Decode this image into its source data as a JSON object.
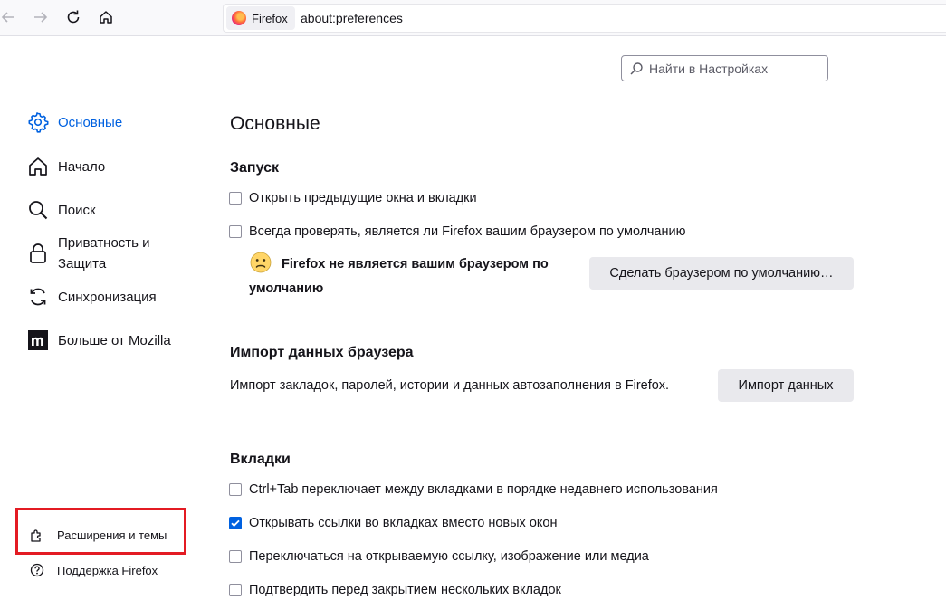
{
  "browser": {
    "identity_label": "Firefox",
    "url": "about:preferences"
  },
  "search": {
    "placeholder": "Найти в Настройках"
  },
  "sidebar": {
    "items": [
      {
        "label": "Основные",
        "icon": "gear-icon",
        "selected": true
      },
      {
        "label": "Начало",
        "icon": "home-icon"
      },
      {
        "label": "Поиск",
        "icon": "search-icon"
      },
      {
        "label_line1": "Приватность и",
        "label_line2": "Защита",
        "icon": "lock-icon"
      },
      {
        "label": "Синхронизация",
        "icon": "sync-icon"
      },
      {
        "label": "Больше от Mozilla",
        "icon": "mozilla-m-icon"
      }
    ],
    "footer": {
      "extensions": "Расширения и темы",
      "support": "Поддержка Firefox"
    }
  },
  "main": {
    "title": "Основные",
    "startup": {
      "heading": "Запуск",
      "restore_session": {
        "label": "Открыть предыдущие окна и вкладки",
        "checked": false
      },
      "check_default": {
        "label": "Всегда проверять, является ли Firefox вашим браузером по умолчанию",
        "checked": false
      },
      "not_default_line1": "Firefox не является вашим браузером по",
      "not_default_line2": "умолчанию",
      "make_default_button": "Сделать браузером по умолчанию…"
    },
    "import": {
      "heading": "Импорт данных браузера",
      "description": "Импорт закладок, паролей, истории и данных автозаполнения в Firefox.",
      "button": "Импорт данных"
    },
    "tabs": {
      "heading": "Вкладки",
      "options": [
        {
          "label": "Ctrl+Tab переключает между вкладками в порядке недавнего использования",
          "checked": false
        },
        {
          "label": "Открывать ссылки во вкладках вместо новых окон",
          "checked": true
        },
        {
          "label": "Переключаться на открываемую ссылку, изображение или медиа",
          "checked": false
        },
        {
          "label": "Подтвердить перед закрытием нескольких вкладок",
          "checked": false
        }
      ]
    }
  },
  "colors": {
    "accent": "#0061e0",
    "highlight_box": "#e31b23"
  }
}
